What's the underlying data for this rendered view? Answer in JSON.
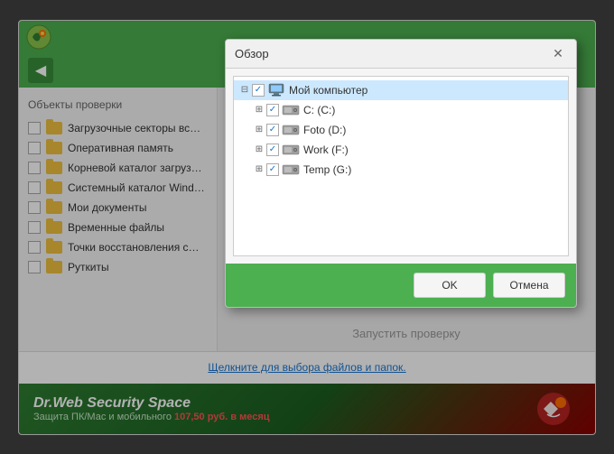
{
  "app": {
    "topbar": {},
    "navbar": {
      "back_label": "◀"
    }
  },
  "left_panel": {
    "title": "Объекты проверки",
    "items": [
      {
        "label": "Загрузочные секторы вс…"
      },
      {
        "label": "Оперативная память"
      },
      {
        "label": "Корневой каталог загруз…"
      },
      {
        "label": "Системный каталог Wind…"
      },
      {
        "label": "Мои документы"
      },
      {
        "label": "Временные файлы"
      },
      {
        "label": "Точки восстановления с…"
      },
      {
        "label": "Руткиты"
      }
    ]
  },
  "bottom": {
    "link_label": "Щелкните для выбора файлов и папок."
  },
  "ad": {
    "title": "Dr.Web Security Space",
    "subtitle": "Защита ПК/Мас и мобильного",
    "price": "107,50 руб. в месяц",
    "price_prefix": "",
    "subtitle_suffix": ""
  },
  "dialog": {
    "title": "Обзор",
    "close_label": "✕",
    "tree": {
      "root": {
        "label": "Мой компьютер",
        "expanded": true,
        "checked": true,
        "children": [
          {
            "label": "C: (C:)",
            "checked": true,
            "expanded": false
          },
          {
            "label": "Foto (D:)",
            "checked": true,
            "expanded": false
          },
          {
            "label": "Work (F:)",
            "checked": true,
            "expanded": false
          },
          {
            "label": "Temp (G:)",
            "checked": true,
            "expanded": false
          }
        ]
      }
    },
    "ok_label": "OK",
    "cancel_label": "Отмена"
  },
  "right_panel": {
    "scan_button_label": "Запустить проверку"
  }
}
